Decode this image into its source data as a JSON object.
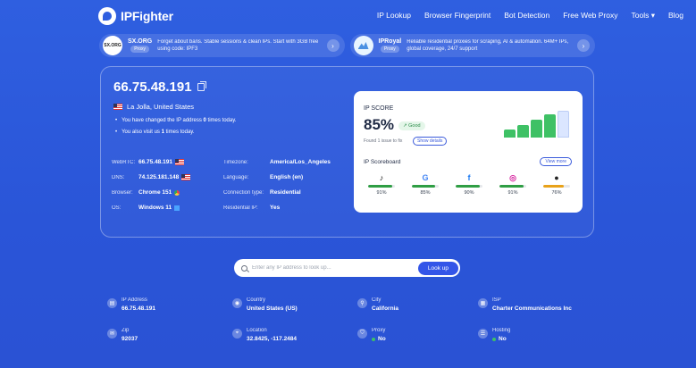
{
  "header": {
    "brand": "IPFighter",
    "nav": [
      "IP Lookup",
      "Browser Fingerprint",
      "Bot Detection",
      "Free Web Proxy",
      "Tools ▾",
      "Blog"
    ]
  },
  "ads": [
    {
      "logo_text": "SX.ORG",
      "name": "SX.ORG",
      "tag": "Proxy",
      "text": "Forget about bans. Stable sessions & clean IPs. Start with 3GB free using code: IPF3"
    },
    {
      "logo_text": "",
      "name": "IPRoyal",
      "tag": "Proxy",
      "text": "Reliable residential proxies for scraping, AI & automation. 64M+ IPs, global coverage, 24/7 support"
    }
  ],
  "summary": {
    "ip": "66.75.48.191",
    "location": "La Jolla, United States",
    "bullet1_pre": "You have changed the IP address ",
    "bullet1_num": "0",
    "bullet1_post": " times today.",
    "bullet2_pre": "You also visit us ",
    "bullet2_num": "1",
    "bullet2_post": " times today."
  },
  "details": [
    {
      "label": "WebRTC:",
      "value": "66.75.48.191",
      "label2": "Timezone:",
      "value2": "America/Los_Angeles"
    },
    {
      "label": "DNS:",
      "value": "74.125.181.148",
      "label2": "Language:",
      "value2": "English (en)"
    },
    {
      "label": "Browser:",
      "value": "Chrome 151",
      "label2": "Connection type:",
      "value2": "Residential"
    },
    {
      "label": "OS:",
      "value": "Windows 11",
      "label2": "Residential IP:",
      "value2": "Yes"
    }
  ],
  "score": {
    "label": "IP SCORE",
    "value": "85%",
    "badge": "Good",
    "found": "Found 1 issue to fix",
    "show_details": "Show details",
    "bar_levels": [
      0.3,
      0.45,
      0.65,
      0.85,
      1.0
    ],
    "scoreboard_label": "IP Scoreboard",
    "view_more": "View more",
    "items": [
      {
        "icon": "tiktok-icon",
        "glyph": "♪",
        "color": "#111111",
        "value": "91%",
        "pct": 91,
        "bar": "#2f9e44"
      },
      {
        "icon": "google-icon",
        "glyph": "G",
        "color": "#4285f4",
        "value": "85%",
        "pct": 85,
        "bar": "#2f9e44"
      },
      {
        "icon": "facebook-icon",
        "glyph": "f",
        "color": "#1877f2",
        "value": "90%",
        "pct": 90,
        "bar": "#2f9e44"
      },
      {
        "icon": "instagram-icon",
        "glyph": "◎",
        "color": "#d6249f",
        "value": "91%",
        "pct": 91,
        "bar": "#2f9e44"
      },
      {
        "icon": "user-icon",
        "glyph": "●",
        "color": "#222222",
        "value": "76%",
        "pct": 76,
        "bar": "#e8a21a"
      }
    ]
  },
  "search": {
    "placeholder": "Enter any IP address to look up...",
    "button": "Look up"
  },
  "info": [
    {
      "label": "IP Address",
      "value": "66.75.48.191",
      "icon": "ip-icon"
    },
    {
      "label": "Country",
      "value": "United States (US)",
      "icon": "globe-icon"
    },
    {
      "label": "City",
      "value": "California",
      "icon": "pin-icon"
    },
    {
      "label": "ISP",
      "value": "Charter Communications Inc",
      "icon": "building-icon"
    },
    {
      "label": "Zip",
      "value": "92037",
      "icon": "zip-icon"
    },
    {
      "label": "Location",
      "value": "32.8425, -117.2484",
      "icon": "location-icon"
    },
    {
      "label": "Proxy",
      "value": "No",
      "icon": "proxy-icon"
    },
    {
      "label": "Hosting",
      "value": "No",
      "icon": "hosting-icon"
    }
  ]
}
